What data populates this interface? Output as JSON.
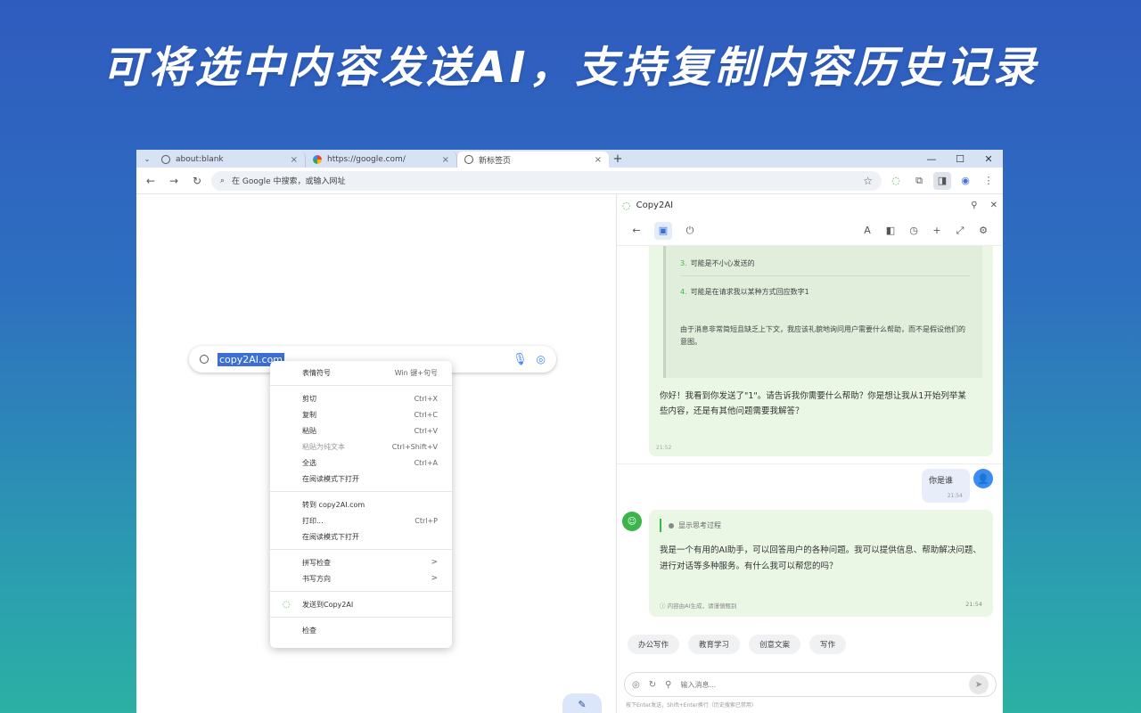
{
  "headline": "可将选中内容发送AI，支持复制内容历史记录",
  "browser": {
    "tabs": [
      {
        "label": "about:blank",
        "close": "×"
      },
      {
        "label": "https://google.com/",
        "close": "×"
      },
      {
        "label": "新标签页",
        "close": "×"
      }
    ],
    "new_tab": "+",
    "window_controls": {
      "minimize": "—",
      "maximize": "☐",
      "close": "✕"
    },
    "tab_menu": "⌄",
    "nav": {
      "back": "←",
      "forward": "→",
      "reload": "↻"
    },
    "omnibox_placeholder": "在 Google 中搜索，或输入网址",
    "bookmark_star": "☆",
    "menu": "⋮"
  },
  "page": {
    "search_selected_text": "copy2AI.com",
    "context_menu": {
      "groups": [
        [
          {
            "label": "表情符号",
            "shortcut": "Win 键+句号"
          }
        ],
        [
          {
            "label": "剪切",
            "shortcut": "Ctrl+X"
          },
          {
            "label": "复制",
            "shortcut": "Ctrl+C"
          },
          {
            "label": "粘贴",
            "shortcut": "Ctrl+V"
          },
          {
            "label": "粘贴为纯文本",
            "shortcut": "Ctrl+Shift+V",
            "disabled": true
          },
          {
            "label": "全选",
            "shortcut": "Ctrl+A"
          },
          {
            "label": "在阅读模式下打开",
            "shortcut": ""
          }
        ],
        [
          {
            "label": "转到 copy2AI.com",
            "shortcut": ""
          },
          {
            "label": "打印...",
            "shortcut": "Ctrl+P"
          },
          {
            "label": "在阅读模式下打开",
            "shortcut": ""
          }
        ],
        [
          {
            "label": "拼写检查",
            "shortcut": "",
            "submenu": ">"
          },
          {
            "label": "书写方向",
            "shortcut": "",
            "submenu": ">"
          }
        ],
        [
          {
            "label": "发送到Copy2AI",
            "shortcut": "",
            "icon": "copy2ai-icon"
          }
        ],
        [
          {
            "label": "检查",
            "shortcut": ""
          }
        ]
      ]
    }
  },
  "panel": {
    "title": "Copy2AI",
    "pin": "⚲",
    "close": "✕",
    "tools_left": [
      "←",
      "▣",
      "⏻"
    ],
    "tools_right": [
      "A",
      "◧",
      "◷",
      "+",
      "⤢",
      "⚙"
    ],
    "quote_items": [
      {
        "num": "3.",
        "text": "可能是不小心发送的"
      },
      {
        "num": "4.",
        "text": "可能是在请求我以某种方式回应数字1"
      }
    ],
    "quote_footer": "由于消息非常简短且缺乏上下文，我应该礼貌地询问用户需要什么帮助，而不是假设他们的意图。",
    "reply1": "你好！我看到你发送了\"1\"。请告诉我你需要什么帮助？你是想让我从1开始列举某些内容，还是有其他问题需要我解答？",
    "reply1_time": "21:52",
    "user_message": "你是谁",
    "user_time": "21:54",
    "thinking_label": "显示思考过程",
    "reply2": "我是一个有用的AI助手，可以回答用户的各种问题。我可以提供信息、帮助解决问题、进行对话等多种服务。有什么我可以帮您的吗？",
    "reply2_disclaimer": "内容由AI生成，请谨慎甄别",
    "reply2_time": "21:54",
    "chips": [
      "办公写作",
      "教育学习",
      "创意文案",
      "写作"
    ],
    "input_placeholder": "输入消息...",
    "input_hint": "按下Enter发送，Shift+Enter换行（历史搜索已禁用）"
  }
}
